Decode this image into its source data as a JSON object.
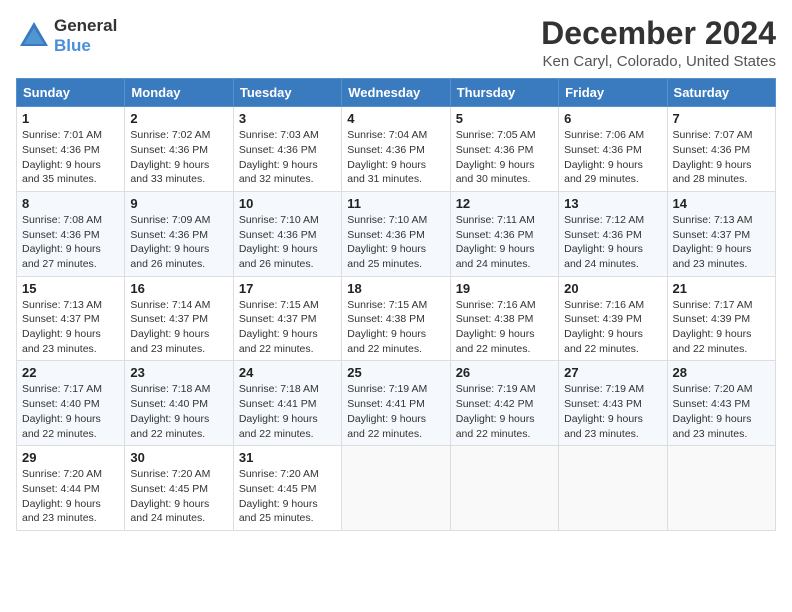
{
  "header": {
    "logo_general": "General",
    "logo_blue": "Blue",
    "month_title": "December 2024",
    "location": "Ken Caryl, Colorado, United States"
  },
  "calendar": {
    "weekdays": [
      "Sunday",
      "Monday",
      "Tuesday",
      "Wednesday",
      "Thursday",
      "Friday",
      "Saturday"
    ],
    "weeks": [
      [
        {
          "day": "1",
          "sunrise": "7:01 AM",
          "sunset": "4:36 PM",
          "daylight": "9 hours and 35 minutes."
        },
        {
          "day": "2",
          "sunrise": "7:02 AM",
          "sunset": "4:36 PM",
          "daylight": "9 hours and 33 minutes."
        },
        {
          "day": "3",
          "sunrise": "7:03 AM",
          "sunset": "4:36 PM",
          "daylight": "9 hours and 32 minutes."
        },
        {
          "day": "4",
          "sunrise": "7:04 AM",
          "sunset": "4:36 PM",
          "daylight": "9 hours and 31 minutes."
        },
        {
          "day": "5",
          "sunrise": "7:05 AM",
          "sunset": "4:36 PM",
          "daylight": "9 hours and 30 minutes."
        },
        {
          "day": "6",
          "sunrise": "7:06 AM",
          "sunset": "4:36 PM",
          "daylight": "9 hours and 29 minutes."
        },
        {
          "day": "7",
          "sunrise": "7:07 AM",
          "sunset": "4:36 PM",
          "daylight": "9 hours and 28 minutes."
        }
      ],
      [
        {
          "day": "8",
          "sunrise": "7:08 AM",
          "sunset": "4:36 PM",
          "daylight": "9 hours and 27 minutes."
        },
        {
          "day": "9",
          "sunrise": "7:09 AM",
          "sunset": "4:36 PM",
          "daylight": "9 hours and 26 minutes."
        },
        {
          "day": "10",
          "sunrise": "7:10 AM",
          "sunset": "4:36 PM",
          "daylight": "9 hours and 26 minutes."
        },
        {
          "day": "11",
          "sunrise": "7:10 AM",
          "sunset": "4:36 PM",
          "daylight": "9 hours and 25 minutes."
        },
        {
          "day": "12",
          "sunrise": "7:11 AM",
          "sunset": "4:36 PM",
          "daylight": "9 hours and 24 minutes."
        },
        {
          "day": "13",
          "sunrise": "7:12 AM",
          "sunset": "4:36 PM",
          "daylight": "9 hours and 24 minutes."
        },
        {
          "day": "14",
          "sunrise": "7:13 AM",
          "sunset": "4:37 PM",
          "daylight": "9 hours and 23 minutes."
        }
      ],
      [
        {
          "day": "15",
          "sunrise": "7:13 AM",
          "sunset": "4:37 PM",
          "daylight": "9 hours and 23 minutes."
        },
        {
          "day": "16",
          "sunrise": "7:14 AM",
          "sunset": "4:37 PM",
          "daylight": "9 hours and 23 minutes."
        },
        {
          "day": "17",
          "sunrise": "7:15 AM",
          "sunset": "4:37 PM",
          "daylight": "9 hours and 22 minutes."
        },
        {
          "day": "18",
          "sunrise": "7:15 AM",
          "sunset": "4:38 PM",
          "daylight": "9 hours and 22 minutes."
        },
        {
          "day": "19",
          "sunrise": "7:16 AM",
          "sunset": "4:38 PM",
          "daylight": "9 hours and 22 minutes."
        },
        {
          "day": "20",
          "sunrise": "7:16 AM",
          "sunset": "4:39 PM",
          "daylight": "9 hours and 22 minutes."
        },
        {
          "day": "21",
          "sunrise": "7:17 AM",
          "sunset": "4:39 PM",
          "daylight": "9 hours and 22 minutes."
        }
      ],
      [
        {
          "day": "22",
          "sunrise": "7:17 AM",
          "sunset": "4:40 PM",
          "daylight": "9 hours and 22 minutes."
        },
        {
          "day": "23",
          "sunrise": "7:18 AM",
          "sunset": "4:40 PM",
          "daylight": "9 hours and 22 minutes."
        },
        {
          "day": "24",
          "sunrise": "7:18 AM",
          "sunset": "4:41 PM",
          "daylight": "9 hours and 22 minutes."
        },
        {
          "day": "25",
          "sunrise": "7:19 AM",
          "sunset": "4:41 PM",
          "daylight": "9 hours and 22 minutes."
        },
        {
          "day": "26",
          "sunrise": "7:19 AM",
          "sunset": "4:42 PM",
          "daylight": "9 hours and 22 minutes."
        },
        {
          "day": "27",
          "sunrise": "7:19 AM",
          "sunset": "4:43 PM",
          "daylight": "9 hours and 23 minutes."
        },
        {
          "day": "28",
          "sunrise": "7:20 AM",
          "sunset": "4:43 PM",
          "daylight": "9 hours and 23 minutes."
        }
      ],
      [
        {
          "day": "29",
          "sunrise": "7:20 AM",
          "sunset": "4:44 PM",
          "daylight": "9 hours and 23 minutes."
        },
        {
          "day": "30",
          "sunrise": "7:20 AM",
          "sunset": "4:45 PM",
          "daylight": "9 hours and 24 minutes."
        },
        {
          "day": "31",
          "sunrise": "7:20 AM",
          "sunset": "4:45 PM",
          "daylight": "9 hours and 25 minutes."
        },
        null,
        null,
        null,
        null
      ]
    ],
    "labels": {
      "sunrise": "Sunrise:",
      "sunset": "Sunset:",
      "daylight": "Daylight:"
    }
  }
}
